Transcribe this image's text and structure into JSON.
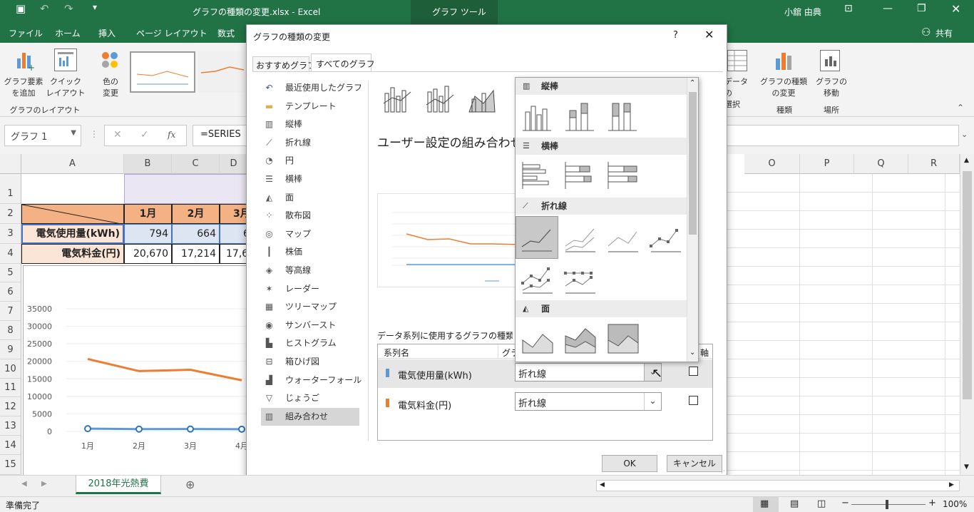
{
  "window": {
    "title": "グラフの種類の変更.xlsx  -  Excel",
    "context_tab": "グラフ ツール",
    "user": "小舘 由典"
  },
  "tabs": [
    "ファイル",
    "ホーム",
    "挿入",
    "ページ レイアウト",
    "数式"
  ],
  "share_label": "共有",
  "ribbon": {
    "add_element": "グラフ要素\nを追加",
    "quick_layout": "クイック\nレイアウト",
    "change_color": "色の\n変更",
    "group_layout": "グラフのレイアウト",
    "select_data": "データの\n選択",
    "change_type": "グラフの種類\nの変更",
    "move_chart": "グラフの\n移動",
    "group_type": "種類",
    "group_location": "場所"
  },
  "formula_bar": {
    "name_box": "グラフ 1",
    "formula": "=SERIES"
  },
  "columns": [
    "A",
    "B",
    "C",
    "D",
    "O",
    "P",
    "Q",
    "R"
  ],
  "rows": [
    "1",
    "2",
    "3",
    "4",
    "5",
    "6",
    "7",
    "8",
    "9",
    "10",
    "11",
    "12",
    "13",
    "14",
    "15"
  ],
  "sheet": {
    "months": [
      "1月",
      "2月",
      "3月"
    ],
    "row3_label": "電気使用量(kWh)",
    "row3_values": [
      "794",
      "664",
      "6"
    ],
    "row4_label": "電気料金(円)",
    "row4_values": [
      "20,670",
      "17,214",
      "17,6"
    ]
  },
  "chart_data": {
    "type": "line",
    "categories": [
      "1月",
      "2月",
      "3月",
      "4月"
    ],
    "series": [
      {
        "values": [
          20670,
          17214,
          17600,
          14600
        ],
        "color": "#ED7D31"
      },
      {
        "values": [
          794,
          664,
          680,
          640
        ],
        "color": "#5B9BD5"
      }
    ],
    "y_ticks": [
      "35000",
      "30000",
      "25000",
      "20000",
      "15000",
      "10000",
      "5000",
      "0"
    ],
    "ylim": [
      0,
      35000
    ]
  },
  "dialog": {
    "title": "グラフの種類の変更",
    "help": "?",
    "tab_recommended": "おすすめグラフ",
    "tab_all": "すべてのグラフ",
    "categories": [
      {
        "label": "最近使用したグラフ",
        "icon": "recent-icon"
      },
      {
        "label": "テンプレート",
        "icon": "folder-icon"
      },
      {
        "label": "縦棒",
        "icon": "column-chart-icon"
      },
      {
        "label": "折れ線",
        "icon": "line-chart-icon"
      },
      {
        "label": "円",
        "icon": "pie-chart-icon"
      },
      {
        "label": "横棒",
        "icon": "bar-chart-icon"
      },
      {
        "label": "面",
        "icon": "area-chart-icon"
      },
      {
        "label": "散布図",
        "icon": "scatter-chart-icon"
      },
      {
        "label": "マップ",
        "icon": "map-chart-icon"
      },
      {
        "label": "株価",
        "icon": "stock-chart-icon"
      },
      {
        "label": "等高線",
        "icon": "surface-chart-icon"
      },
      {
        "label": "レーダー",
        "icon": "radar-chart-icon"
      },
      {
        "label": "ツリーマップ",
        "icon": "treemap-icon"
      },
      {
        "label": "サンバースト",
        "icon": "sunburst-icon"
      },
      {
        "label": "ヒストグラム",
        "icon": "histogram-icon"
      },
      {
        "label": "箱ひげ図",
        "icon": "box-whisker-icon"
      },
      {
        "label": "ウォーターフォール",
        "icon": "waterfall-icon"
      },
      {
        "label": "じょうご",
        "icon": "funnel-icon"
      },
      {
        "label": "組み合わせ",
        "icon": "combo-chart-icon"
      }
    ],
    "combo_title": "ユーザー設定の組み合わせ",
    "series_caption": "データ系列に使用するグラフの種類と軸",
    "col_series": "系列名",
    "col_type": "グラ",
    "col_axis": "軸",
    "series_rows": [
      {
        "name": "電気使用量(kWh)",
        "type": "折れ線",
        "color": "#5B9BD5"
      },
      {
        "name": "電気料金(円)",
        "type": "折れ線",
        "color": "#ED7D31"
      }
    ],
    "ok": "OK",
    "cancel": "キャンセル"
  },
  "popup": {
    "sections": [
      "縦棒",
      "横棒",
      "折れ線",
      "面"
    ]
  },
  "sheet_tab": "2018年光熱費",
  "status": {
    "ready": "準備完了",
    "zoom": "100%"
  }
}
